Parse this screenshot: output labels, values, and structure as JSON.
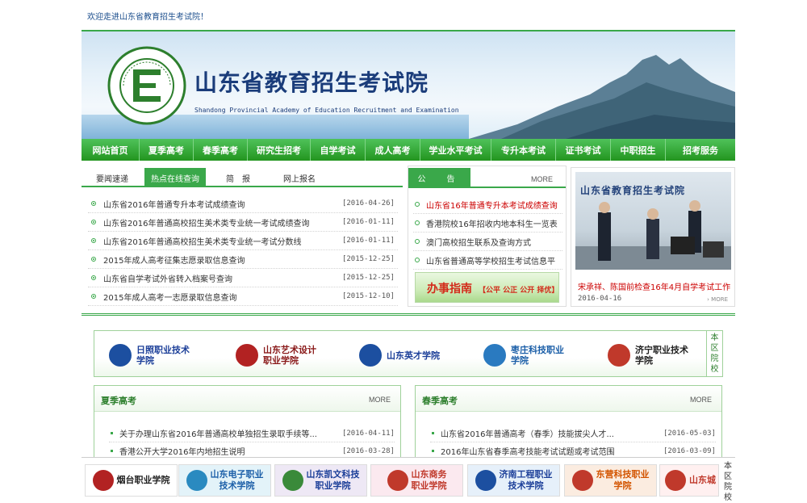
{
  "header": {
    "welcome": "欢迎走进山东省教育招生考试院！",
    "title": "山东省教育招生考试院",
    "subtitle": "Shandong Provincial Academy of Education Recruitment and Examination",
    "emblem_text": "Shandong Education Admissions & Examinations 山东省教育招生考试"
  },
  "nav": {
    "items": [
      "网站首页",
      "夏季高考",
      "春季高考",
      "研究生招考",
      "自学考试",
      "成人高考",
      "学业水平考试",
      "专升本考试",
      "证书考试",
      "中职招生",
      "招考服务"
    ]
  },
  "tabs": {
    "items": [
      "要闻速递",
      "热点在线查询",
      "简　报",
      "网上报名"
    ],
    "active": 1
  },
  "hot_list": [
    {
      "title": "山东省2016年普通专升本考试成绩查询",
      "date": "[2016-04-26]"
    },
    {
      "title": "山东省2016年普通高校招生美术类专业统一考试成绩查询",
      "date": "[2016-01-11]"
    },
    {
      "title": "山东省2016年普通高校招生美术类专业统一考试分数线",
      "date": "[2016-01-11]"
    },
    {
      "title": "2015年成人高考征集志愿录取信息查询",
      "date": "[2015-12-25]"
    },
    {
      "title": "山东省自学考试外省转入档案号查询",
      "date": "[2015-12-25]"
    },
    {
      "title": "2015年成人高考一志愿录取信息查询",
      "date": "[2015-12-10]"
    }
  ],
  "notice": {
    "title": "公　告",
    "more": "MORE",
    "items": [
      {
        "title": "山东省16年普通专升本考试成绩查询",
        "hot": true
      },
      {
        "title": "香港院校16年招收内地本科生一览表",
        "hot": false
      },
      {
        "title": "澳门高校招生联系及查询方式",
        "hot": false
      },
      {
        "title": "山东省普通高等学校招生考试信息平",
        "hot": false
      }
    ],
    "guide_title": "办事指南",
    "guide_slogan": "【公平 公正 公开 择优】"
  },
  "photo_news": {
    "wall_text": "山东省教育招生考试院",
    "caption": "宋承祥、陈国前检查16年4月自学考试工作",
    "date": "2016-04-16",
    "more": "› MORE"
  },
  "schools": {
    "side_label": "本区院校",
    "items": [
      {
        "name1": "日照职业技术",
        "name2": "学院",
        "color": "#1c3f99",
        "logo_color": "#1c4fa0"
      },
      {
        "name1": "山东艺术设计",
        "name2": "职业学院",
        "color": "#8a1a1a",
        "logo_color": "#b22222"
      },
      {
        "name1": "山东英才学院",
        "name2": "",
        "color": "#1c3f99",
        "logo_color": "#1c4fa0"
      },
      {
        "name1": "枣庄科技职业",
        "name2": "学院",
        "color": "#1c5fa8",
        "logo_color": "#2a7ac0"
      },
      {
        "name1": "济宁职业技术",
        "name2": "学院",
        "color": "#222222",
        "logo_color": "#c0392b"
      }
    ]
  },
  "summer": {
    "title": "夏季高考",
    "more": "MORE",
    "items": [
      {
        "title": "关于办理山东省2016年普通高校单独招生录取手续等...",
        "date": "[2016-04-11]"
      },
      {
        "title": "香港公开大学2016年内地招生说明",
        "date": "[2016-03-28]"
      }
    ]
  },
  "spring": {
    "title": "春季高考",
    "more": "MORE",
    "items": [
      {
        "title": "山东省2016年普通高考（春季）技能拔尖人才...",
        "date": "[2016-05-03]"
      },
      {
        "title": "2016年山东省春季高考技能考试试题或考试范围",
        "date": "[2016-03-09]"
      }
    ]
  },
  "float_bar": {
    "side_label": "本区院校",
    "items": [
      {
        "name1": "烟台职业学院",
        "name2": "",
        "color": "#222222",
        "bg": "#ffffff",
        "logo": "#b22222"
      },
      {
        "name1": "山东电子职业",
        "name2": "技术学院",
        "color": "#1c5fa8",
        "bg": "#e3f3f9",
        "logo": "#2a8ac0"
      },
      {
        "name1": "山东凯文科技",
        "name2": "职业学院",
        "color": "#1c3f99",
        "bg": "#eee8f5",
        "logo": "#3a8a3a"
      },
      {
        "name1": "山东商务",
        "name2": "职业学院",
        "color": "#c0392b",
        "bg": "#fbe9ef",
        "logo": "#c0392b"
      },
      {
        "name1": "济南工程职业",
        "name2": "技术学院",
        "color": "#1c3f99",
        "bg": "#e6f0fa",
        "logo": "#1c4fa0"
      },
      {
        "name1": "东营科技职业",
        "name2": "学院",
        "color": "#d35400",
        "bg": "#fbece0",
        "logo": "#c0392b"
      },
      {
        "name1": "山东城",
        "name2": "",
        "color": "#c0392b",
        "bg": "#fff0f0",
        "logo": "#c0392b"
      }
    ]
  }
}
